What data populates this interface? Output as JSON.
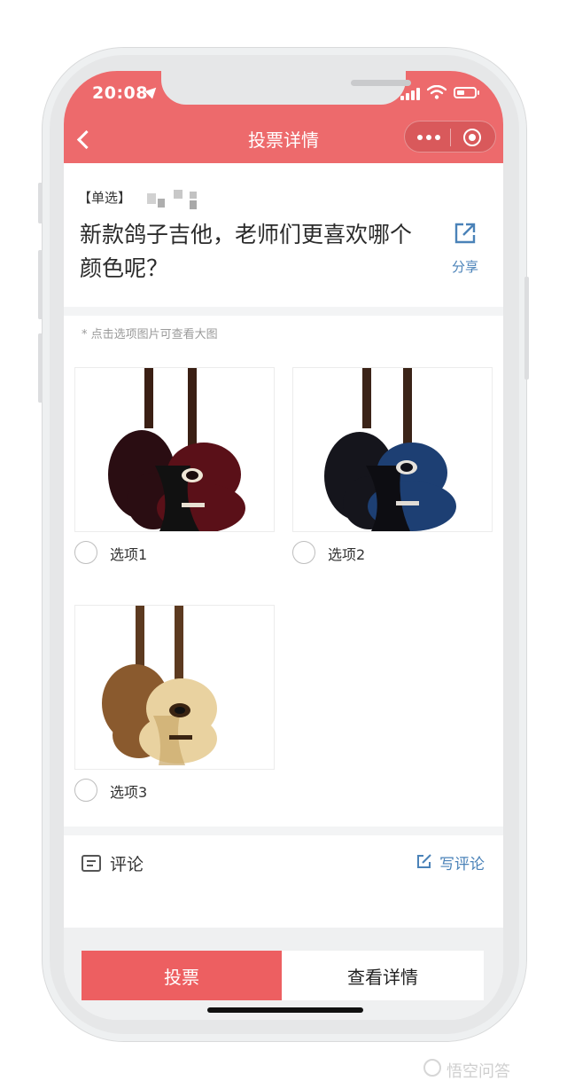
{
  "status_bar": {
    "time": "20:08"
  },
  "nav": {
    "title": "投票详情"
  },
  "question": {
    "tag": "【单选】",
    "text": "新款鸽子吉他，老师们更喜欢哪个颜色呢？",
    "share_label": "分享"
  },
  "options_hint": "* 点击选项图片可查看大图",
  "options": [
    {
      "label": "选项1",
      "colors": {
        "body": "#5a1018",
        "neck": "#3a1f14",
        "back_body": "#2a0d12"
      }
    },
    {
      "label": "选项2",
      "colors": {
        "body": "#1d3f73",
        "neck": "#3b2418",
        "back_body": "#15151c"
      }
    },
    {
      "label": "选项3",
      "colors": {
        "body": "#e9d2a0",
        "neck": "#5c3a20",
        "back_body": "#8a5a2e"
      }
    }
  ],
  "comments": {
    "title": "评论",
    "write_label": "写评论"
  },
  "actions": {
    "vote_label": "投票",
    "details_label": "查看详情"
  },
  "watermark": "悟空问答",
  "colors": {
    "accent": "#ed6a6c",
    "vote": "#ed5f61",
    "link": "#4a82b8"
  }
}
